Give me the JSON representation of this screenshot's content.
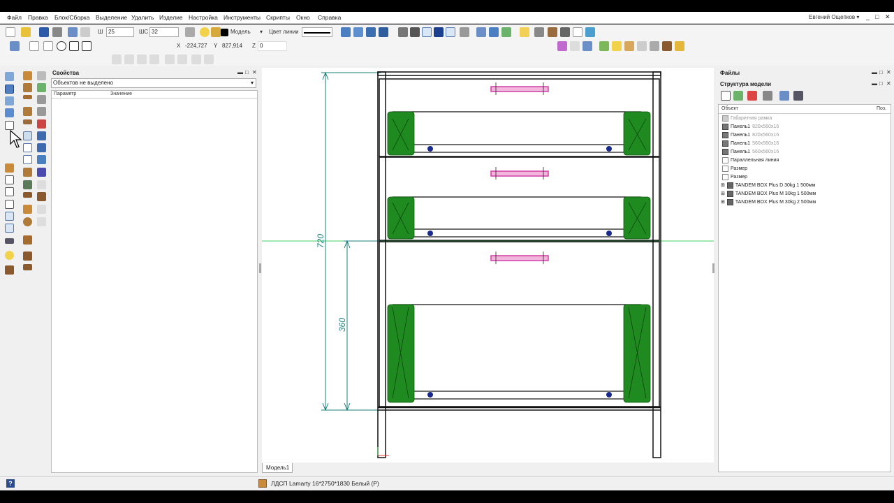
{
  "menu": [
    "Файл",
    "Правка",
    "Блок/Сборка",
    "Выделение",
    "Удалить",
    "Изделие",
    "Настройка",
    "Инструменты",
    "Скрипты",
    "Окно",
    "Справка"
  ],
  "user": "Евгений Ощепков",
  "user_caret": "▾",
  "window_controls": {
    "min": "_",
    "max": "□",
    "close": "✕"
  },
  "toolbar": {
    "w_label": "Ш",
    "w_value": "25",
    "shc_label": "ШС",
    "shc_value": "32",
    "layer_value": "Модель",
    "line_color_label": "Цвет линии"
  },
  "coords": {
    "x_label": "X",
    "x_value": "-224,727",
    "y_label": "Y",
    "y_value": "827,914",
    "z_label": "Z",
    "z_value": "0"
  },
  "properties": {
    "title": "Свойства",
    "selection": "Объектов не выделено",
    "col_param": "Параметр",
    "col_value": "Значение"
  },
  "files": {
    "title": "Файлы"
  },
  "structure": {
    "title": "Структура модели",
    "col_object": "Объект",
    "col_pos": "Поз.",
    "items": [
      {
        "name": "Габаритная рамка",
        "dims": "",
        "disabled": true
      },
      {
        "name": "Панель1",
        "dims": "820x560x16",
        "disabled": false
      },
      {
        "name": "Панель1",
        "dims": "820x560x16",
        "disabled": false
      },
      {
        "name": "Панель1",
        "dims": "560x560x16",
        "disabled": false
      },
      {
        "name": "Панель1",
        "dims": "560x560x16",
        "disabled": false
      },
      {
        "name": "Параллельная линия",
        "dims": "",
        "disabled": false
      },
      {
        "name": "Размер",
        "dims": "",
        "disabled": false
      },
      {
        "name": "Размер",
        "dims": "",
        "disabled": false
      },
      {
        "name": "TANDEM BOX Plus D 30kg 1  500мм",
        "dims": "",
        "disabled": false
      },
      {
        "name": "TANDEM BOX Plus M 30kg 1  500мм",
        "dims": "",
        "disabled": false
      },
      {
        "name": "TANDEM BOX Plus M 30kg 2  500мм",
        "dims": "",
        "disabled": false
      }
    ]
  },
  "drawing": {
    "dim_total": "720",
    "dim_lower": "360"
  },
  "tab_model": "Модель1",
  "status_material": "ЛДСП Lamarty 16*2750*1830 Белый (Р)",
  "status_help": "?",
  "colors": {
    "dimension": "#1a7f7a",
    "drawer_runner": "#1f8a1f",
    "handle": "#d23fa8",
    "guide": "#3fcf5f"
  }
}
